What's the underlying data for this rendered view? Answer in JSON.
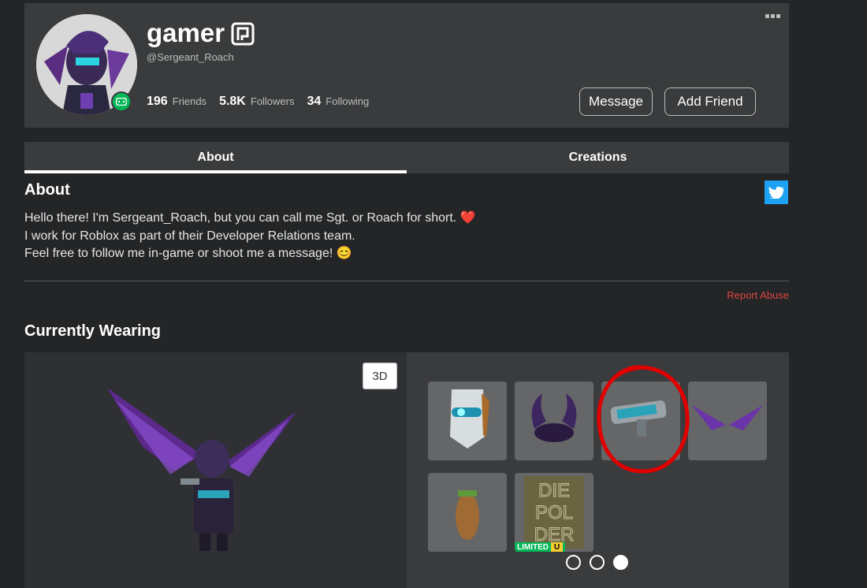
{
  "profile": {
    "display_name": "gamer",
    "username": "@Sergeant_Roach",
    "friends_count": "196",
    "friends_label": "Friends",
    "followers_count": "5.8K",
    "followers_label": "Followers",
    "following_count": "34",
    "following_label": "Following",
    "message_label": "Message",
    "add_friend_label": "Add Friend",
    "presence_color": "#02b757"
  },
  "tabs": [
    {
      "label": "About",
      "active": true
    },
    {
      "label": "Creations",
      "active": false
    }
  ],
  "about": {
    "title": "About",
    "bio_lines": [
      "Hello there! I'm Sergeant_Roach, but you can call me Sgt. or Roach for short. ❤️",
      "I work for Roblox as part of their Developer Relations team.",
      "Feel free to follow me in-game or shoot me a message! 😊"
    ],
    "report_label": "Report Abuse"
  },
  "wearing": {
    "title": "Currently Wearing",
    "view_toggle_label": "3D",
    "items": [
      {
        "icon": "visor-mask-icon"
      },
      {
        "icon": "purple-horns-icon"
      },
      {
        "icon": "blaster-gun-icon"
      },
      {
        "icon": "purple-wings-icon"
      },
      {
        "icon": "roach-costume-icon"
      },
      {
        "icon": "die-polder-sign-icon",
        "badge": "LIMITED",
        "badge_suffix": "U"
      }
    ],
    "pagination": {
      "pages": 3,
      "current": 3
    }
  },
  "colors": {
    "background": "#232527",
    "card": "#393b3d",
    "accent_red": "#e0453f",
    "twitter": "#1da1f2",
    "limited_green": "#02b757"
  }
}
